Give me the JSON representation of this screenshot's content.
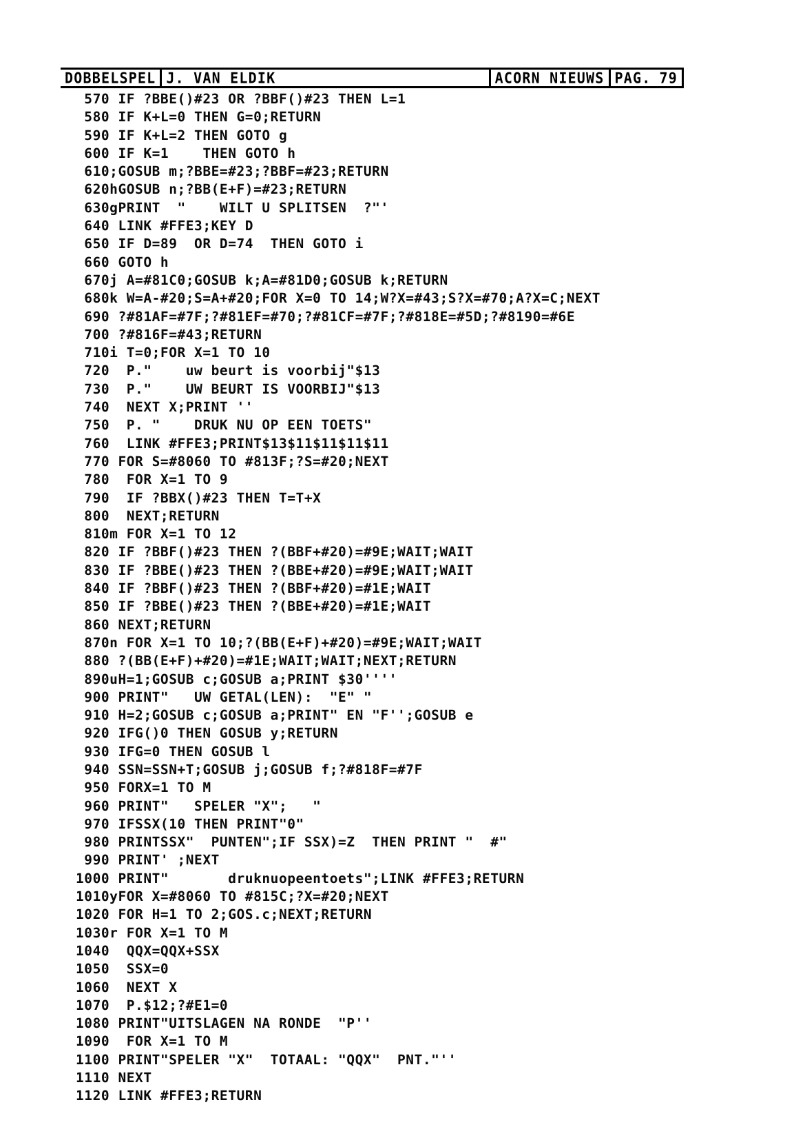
{
  "header": {
    "program_title": "DOBBELSPEL",
    "author": "J. VAN ELDIK",
    "publication": "ACORN NIEUWS",
    "page_label": "PAG.",
    "page_number": "79"
  },
  "listing": {
    "language": "Atom BASIC",
    "lines": [
      " 570 IF ?BBE()#23 OR ?BBF()#23 THEN L=1",
      " 580 IF K+L=0 THEN G=0;RETURN",
      " 590 IF K+L=2 THEN GOTO g",
      " 600 IF K=1    THEN GOTO h",
      " 610;GOSUB m;?BBE=#23;?BBF=#23;RETURN",
      " 620hGOSUB n;?BB(E+F)=#23;RETURN",
      " 630gPRINT  \"    WILT U SPLITSEN  ?\"'",
      " 640 LINK #FFE3;KEY D",
      " 650 IF D=89  OR D=74  THEN GOTO i",
      " 660 GOTO h",
      " 670j A=#81C0;GOSUB k;A=#81D0;GOSUB k;RETURN",
      " 680k W=A-#20;S=A+#20;FOR X=0 TO 14;W?X=#43;S?X=#70;A?X=C;NEXT",
      " 690 ?#81AF=#7F;?#81EF=#70;?#81CF=#7F;?#818E=#5D;?#8190=#6E",
      " 700 ?#816F=#43;RETURN",
      " 710i T=0;FOR X=1 TO 10",
      " 720  P.\"    uw beurt is voorbij\"$13",
      " 730  P.\"    UW BEURT IS VOORBIJ\"$13",
      " 740  NEXT X;PRINT ''",
      " 750  P. \"    DRUK NU OP EEN TOETS\"",
      " 760  LINK #FFE3;PRINT$13$11$11$11$11",
      " 770 FOR S=#8060 TO #813F;?S=#20;NEXT",
      " 780  FOR X=1 TO 9",
      " 790  IF ?BBX()#23 THEN T=T+X",
      " 800  NEXT;RETURN",
      " 810m FOR X=1 TO 12",
      " 820 IF ?BBF()#23 THEN ?(BBF+#20)=#9E;WAIT;WAIT",
      " 830 IF ?BBE()#23 THEN ?(BBE+#20)=#9E;WAIT;WAIT",
      " 840 IF ?BBF()#23 THEN ?(BBF+#20)=#1E;WAIT",
      " 850 IF ?BBE()#23 THEN ?(BBE+#20)=#1E;WAIT",
      " 860 NEXT;RETURN",
      " 870n FOR X=1 TO 10;?(BB(E+F)+#20)=#9E;WAIT;WAIT",
      " 880 ?(BB(E+F)+#20)=#1E;WAIT;WAIT;NEXT;RETURN",
      " 890uH=1;GOSUB c;GOSUB a;PRINT $30''''",
      " 900 PRINT\"   UW GETAL(LEN):  \"E\" \"",
      " 910 H=2;GOSUB c;GOSUB a;PRINT\" EN \"F'';GOSUB e",
      " 920 IFG()0 THEN GOSUB y;RETURN",
      " 930 IFG=0 THEN GOSUB l",
      " 940 SSN=SSN+T;GOSUB j;GOSUB f;?#818F=#7F",
      " 950 FORX=1 TO M",
      " 960 PRINT\"   SPELER \"X\";   \"",
      " 970 IFSSX(10 THEN PRINT\"0\"",
      " 980 PRINTSSX\"  PUNTEN\";IF SSX)=Z  THEN PRINT \"  #\"",
      " 990 PRINT' ;NEXT",
      "1000 PRINT\"       druknuopeentoets\";LINK #FFE3;RETURN",
      "1010yFOR X=#8060 TO #815C;?X=#20;NEXT",
      "1020 FOR H=1 TO 2;GOS.c;NEXT;RETURN",
      "1030r FOR X=1 TO M",
      "1040  QQX=QQX+SSX",
      "1050  SSX=0",
      "1060  NEXT X",
      "1070  P.$12;?#E1=0",
      "1080 PRINT\"UITSLAGEN NA RONDE  \"P''",
      "1090  FOR X=1 TO M",
      "1100 PRINT\"SPELER \"X\"  TOTAAL: \"QQX\"  PNT.\"''",
      "1110 NEXT",
      "1120 LINK #FFE3;RETURN"
    ]
  }
}
